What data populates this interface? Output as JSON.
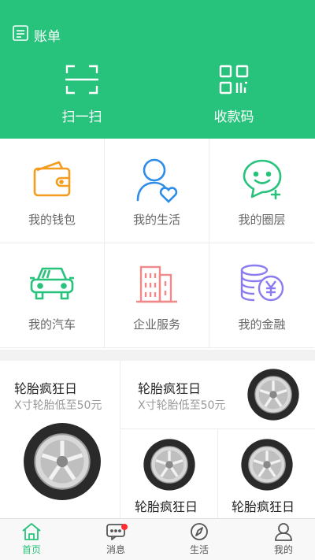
{
  "header": {
    "bill_label": "账单",
    "scan_label": "扫一扫",
    "receive_label": "收款码"
  },
  "grid": {
    "items": [
      {
        "label": "我的钱包",
        "icon": "wallet-icon"
      },
      {
        "label": "我的生活",
        "icon": "user-heart-icon"
      },
      {
        "label": "我的圈层",
        "icon": "chat-smile-icon"
      },
      {
        "label": "我的汽车",
        "icon": "car-icon"
      },
      {
        "label": "企业服务",
        "icon": "building-icon"
      },
      {
        "label": "我的金融",
        "icon": "coins-yen-icon"
      }
    ]
  },
  "promo": {
    "cards": [
      {
        "title": "轮胎疯狂日",
        "subtitle": "X寸轮胎低至50元"
      },
      {
        "title": "轮胎疯狂日",
        "subtitle": "X寸轮胎低至50元"
      },
      {
        "title": "轮胎疯狂日"
      },
      {
        "title": "轮胎疯狂日"
      }
    ]
  },
  "tabbar": {
    "tabs": [
      {
        "label": "首页",
        "icon": "home-icon",
        "active": true
      },
      {
        "label": "消息",
        "icon": "message-icon",
        "badge": true
      },
      {
        "label": "生活",
        "icon": "compass-icon"
      },
      {
        "label": "我的",
        "icon": "profile-icon"
      }
    ]
  },
  "colors": {
    "brand_green": "#27c27b",
    "wallet_orange": "#f39c1e",
    "life_blue": "#2d8de8",
    "circle_green": "#27c27b",
    "finance_purple": "#8a7cf0",
    "building_red": "#f08a8a",
    "badge_red": "#ff2d2d"
  }
}
